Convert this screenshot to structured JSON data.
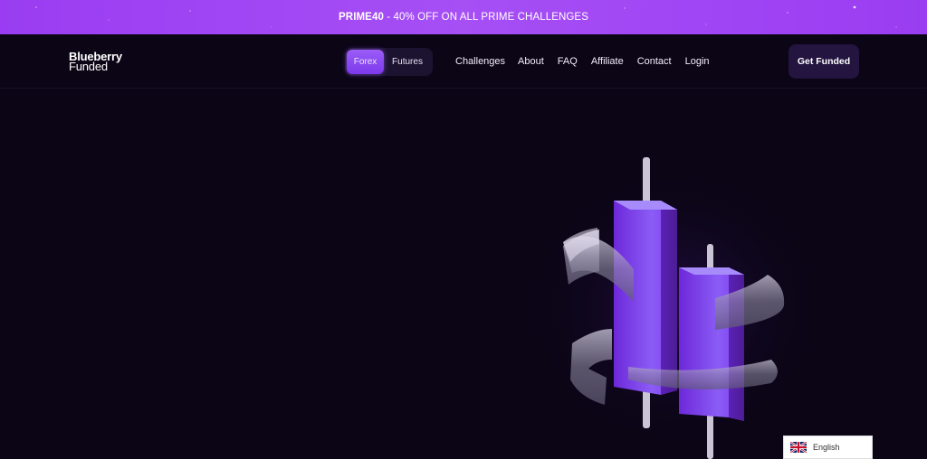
{
  "promo": {
    "code": "PRIME40",
    "text": " - 40% OFF ON ALL PRIME CHALLENGES"
  },
  "brand": {
    "line1": "Blueberry",
    "line2": "Funded"
  },
  "market_toggle": {
    "options": [
      "Forex",
      "Futures"
    ],
    "selected": "Forex"
  },
  "menu": {
    "items": [
      "Challenges",
      "About",
      "FAQ",
      "Affiliate",
      "Contact",
      "Login"
    ]
  },
  "cta": {
    "label": "Get Funded"
  },
  "language": {
    "label": "English",
    "flag_icon": "uk-flag-icon"
  },
  "colors": {
    "promo_bg": "#a14af4",
    "page_bg": "#0b0516",
    "accent": "#7c3aed",
    "cta_bg": "#231440"
  }
}
